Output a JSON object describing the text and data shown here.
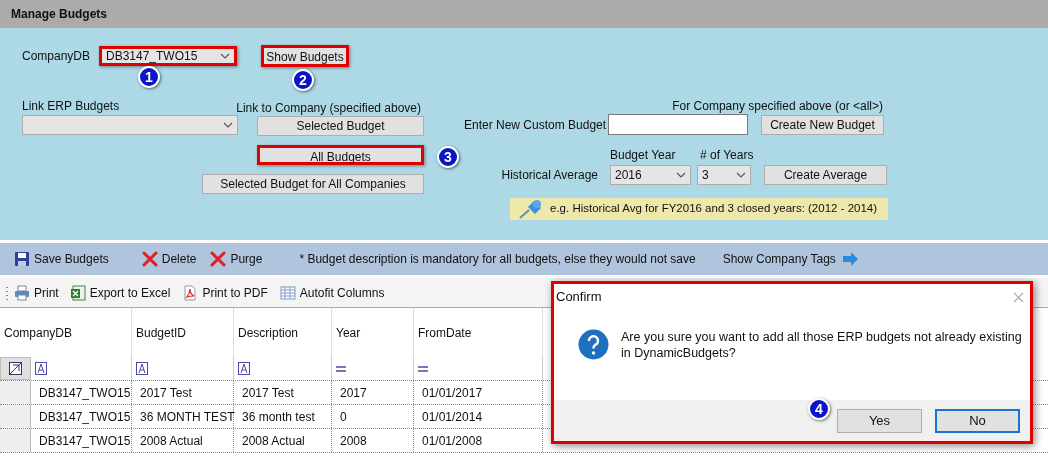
{
  "window": {
    "title": "Manage Budgets"
  },
  "company": {
    "label": "CompanyDB",
    "value": "DB3147_TWO15",
    "highlighted": true,
    "callout": "1"
  },
  "show_budgets": {
    "label": "Show Budgets",
    "highlighted": true,
    "callout": "2"
  },
  "link_erp": {
    "label": "Link ERP Budgets"
  },
  "link_company": {
    "label": "Link to Company (specified above)",
    "buttons": [
      {
        "label": "Selected Budget",
        "highlighted": false
      },
      {
        "label": "All Budgets",
        "highlighted": true,
        "callout": "3"
      },
      {
        "label": "Selected Budget for All Companies",
        "highlighted": false
      }
    ]
  },
  "custom": {
    "heading": "For Company specified above (or <all>)",
    "label": "Enter New Custom Budget",
    "button": "Create New Budget"
  },
  "average": {
    "label": "Historical Average",
    "year_label": "Budget Year",
    "year": "2016",
    "count_label": "# of Years",
    "count": "3",
    "button": "Create Average",
    "note": "e.g. Historical Avg for FY2016 and 3 closed years: (2012 - 2014)"
  },
  "toolbar": [
    {
      "label": "Save Budgets",
      "kind": "save"
    },
    {
      "label": "Delete",
      "kind": "delete"
    },
    {
      "label": "Purge",
      "kind": "delete"
    }
  ],
  "toolbar_note": "* Budget description is mandatory for all budgets, else they would not save",
  "company_tags": "Show Company Tags",
  "grid_toolbar": [
    {
      "label": "Print",
      "kind": "print"
    },
    {
      "label": "Export to Excel",
      "kind": "excel"
    },
    {
      "label": "Print to PDF",
      "kind": "pdf"
    },
    {
      "label": "Autofit Columns",
      "kind": "autofit"
    }
  ],
  "table": {
    "columns": [
      {
        "label": "CompanyDB",
        "kind": "text"
      },
      {
        "label": "BudgetID",
        "kind": "text"
      },
      {
        "label": "Description",
        "kind": "text"
      },
      {
        "label": "Year",
        "kind": "equals"
      },
      {
        "label": "FromDate",
        "kind": "equals"
      }
    ],
    "rows": [
      [
        "DB3147_TWO15",
        "2017 Test",
        "2017 Test",
        "2017",
        "01/01/2017"
      ],
      [
        "DB3147_TWO15",
        "36 MONTH TEST",
        "36 month test",
        "0",
        "01/01/2014"
      ],
      [
        "DB3147_TWO15",
        "2008 Actual",
        "2008 Actual",
        "2008",
        "01/01/2008"
      ]
    ]
  },
  "dialog": {
    "title": "Confirm",
    "highlighted": true,
    "message": "Are you sure you want to add all those ERP budgets not already existing in DynamicBudgets?",
    "buttons": [
      {
        "label": "Yes",
        "selected": false,
        "callout": "4"
      },
      {
        "label": "No",
        "selected": true
      }
    ]
  }
}
